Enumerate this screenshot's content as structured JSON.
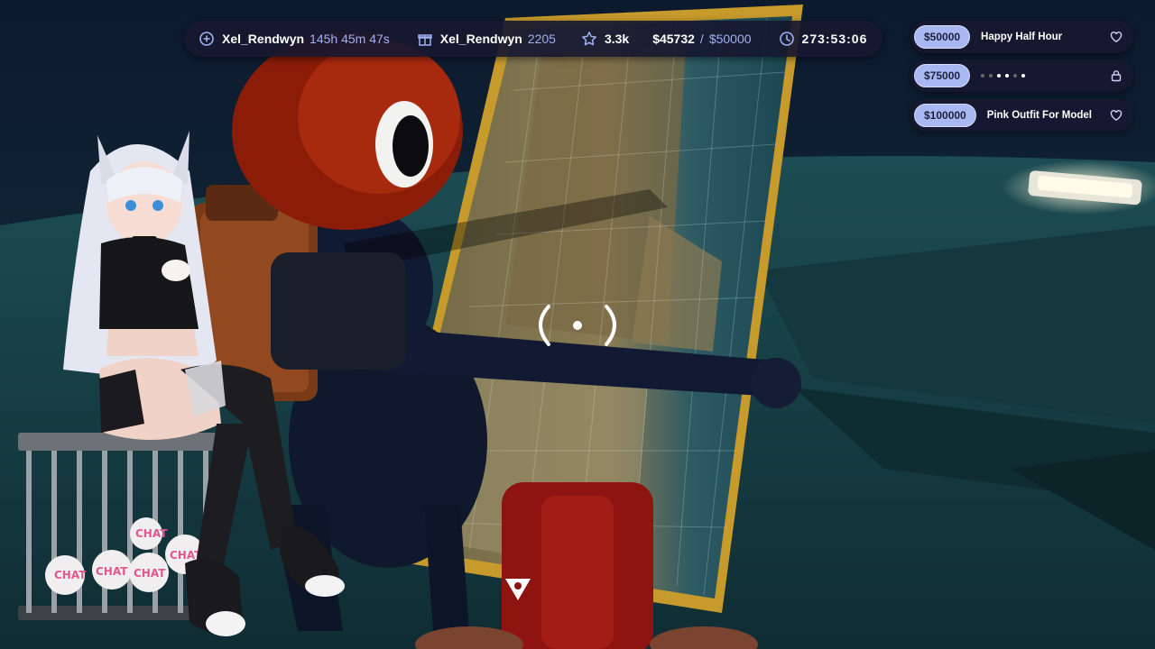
{
  "statbar": {
    "latest_follower": {
      "name": "Xel_Rendwyn",
      "value": "145h 45m 47s",
      "icon": "plus-circle-icon"
    },
    "latest_sub": {
      "name": "Xel_Rendwyn",
      "value": "2205",
      "icon": "gift-icon"
    },
    "followers": {
      "value": "3.3k",
      "icon": "star-icon"
    },
    "donations": {
      "current": "$45732",
      "separator": "/",
      "goal": "$50000"
    },
    "timer": {
      "value": "273:53:06",
      "icon": "clock-icon"
    }
  },
  "goals": [
    {
      "amount": "$50000",
      "label": "Happy Half Hour",
      "icon": "heart-icon",
      "locked": false
    },
    {
      "amount": "$75000",
      "label": "",
      "icon": "lock-icon",
      "locked": true
    },
    {
      "amount": "$100000",
      "label": "Pink Outfit For Model",
      "icon": "heart-icon",
      "locked": false
    }
  ],
  "cage_labels": [
    "CHAT",
    "CHAT",
    "CHAT",
    "CHAT",
    "CHAT"
  ],
  "colors": {
    "panel": "#161830",
    "accent": "#9fb1f0",
    "badge": "#a9b8f2"
  }
}
